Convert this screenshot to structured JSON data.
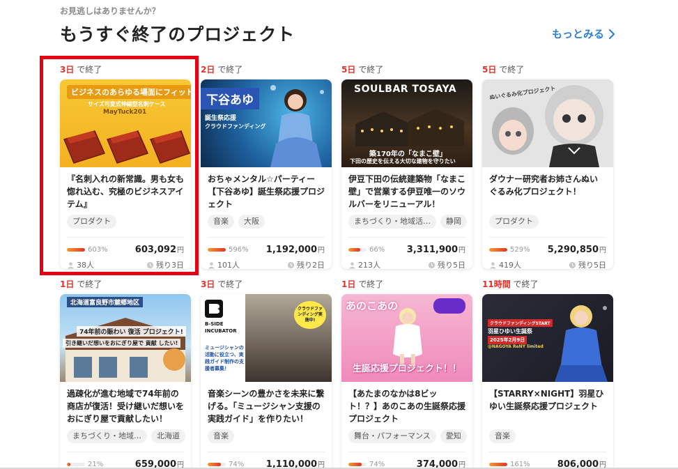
{
  "header": {
    "eyebrow": "お見逃しはありませんか？",
    "title": "もうすぐ終了のプロジェクト",
    "more_link": "もっとみる"
  },
  "cards": [
    {
      "deadline_num": "3日",
      "deadline_suffix": "で終了",
      "thumb_lines": [
        "ビジネスのあらゆる場面にフィット",
        "サイズ可変式伸縮型名刺ケース",
        "MayTuck201"
      ],
      "title": "『名刺入れの新常識。男も女も惚れ込む、究極のビジネスアイテム』",
      "tags": [
        "プロダクト"
      ],
      "percent_text": "603%",
      "percent": 603,
      "amount": "603,092",
      "yen": "円",
      "supporters": "38人",
      "remaining": "残り3日"
    },
    {
      "deadline_num": "2日",
      "deadline_suffix": "で終了",
      "thumb_lines": [
        "下谷あゆ",
        "誕生祭応援",
        "クラウドファンディング"
      ],
      "title": "おちゃメンタル☆パーティー【下谷あゆ】誕生祭応援プロジェクト",
      "tags": [
        "音楽",
        "大阪"
      ],
      "percent_text": "596%",
      "percent": 596,
      "amount": "1,192,000",
      "yen": "円",
      "supporters": "101人",
      "remaining": "残り2日"
    },
    {
      "deadline_num": "5日",
      "deadline_suffix": "で終了",
      "thumb_lines": [
        "SOULBAR TOSAYA",
        "築170年の「なまこ壁」",
        "下田の歴史を伝える大切な建物を守りたい"
      ],
      "title": "伊豆下田の伝統建築物「なまこ壁」で営業する伊豆唯一のソウルバーをリニューアル！",
      "tags": [
        "まちづくり・地域活…",
        "静岡"
      ],
      "percent_text": "66%",
      "percent": 66,
      "amount": "3,311,900",
      "yen": "円",
      "supporters": "213人",
      "remaining": "残り5日"
    },
    {
      "deadline_num": "5日",
      "deadline_suffix": "で終了",
      "thumb_lines": [
        "ぬいぐるみ化プロジェクト"
      ],
      "title": "ダウナー研究者お姉さんぬいぐるみ化プロジェクト！",
      "tags": [
        "プロダクト"
      ],
      "percent_text": "529%",
      "percent": 529,
      "amount": "5,290,850",
      "yen": "円",
      "supporters": "419人",
      "remaining": "残り5日"
    },
    {
      "deadline_num": "1日",
      "deadline_suffix": "で終了",
      "thumb_lines": [
        "北海道富良野市麓郷地区",
        "74年前の賑わい 復活 プロジェクト!",
        "引き継いだ想いをおにぎり屋で 貢献 したい!"
      ],
      "title": "過疎化が進む地域で74年前の商店が復活！受け継いだ想いをおにぎり屋で貢献したい！",
      "tags": [
        "まちづくり・地域…",
        "北海道"
      ],
      "percent_text": "21%",
      "percent": 21,
      "amount": "659,000",
      "yen": "円",
      "supporters": "",
      "remaining": ""
    },
    {
      "deadline_num": "3日",
      "deadline_suffix": "で終了",
      "thumb_lines": [
        "B-SIDE INCUBATOR",
        "ミュージシャンの活動に役立つ、実践ガイド制作の支援者募集！",
        "クラウドファンディング実施中!"
      ],
      "title": "音楽シーンの豊かさを未来に繋げる。「ミュージシャン支援の実践ガイド」を作りたい！",
      "tags": [
        "音楽"
      ],
      "percent_text": "74%",
      "percent": 74,
      "amount": "1,110,000",
      "yen": "円",
      "supporters": "",
      "remaining": ""
    },
    {
      "deadline_num": "1日",
      "deadline_suffix": "で終了",
      "thumb_lines": [
        "あのこあの",
        "生誕応援プロジェクト！！"
      ],
      "title": "【あたまのなかは8ビット！？】あのこあの生誕祭応援プロジェクト",
      "tags": [
        "舞台・パフォーマンス",
        "愛知"
      ],
      "percent_text": "74%",
      "percent": 74,
      "amount": "374,000",
      "yen": "円",
      "supporters": "",
      "remaining": ""
    },
    {
      "deadline_num": "11時間",
      "deadline_suffix": "で終了",
      "thumb_lines": [
        "クラウドファンディングSTART",
        "羽星ひゆい生誕祭",
        "2025年2月9日",
        "@NAGOYA ReNY limited"
      ],
      "title": "【STARRY×NIGHT】羽星ひゆい生誕祭応援プロジェクト",
      "tags": [
        "音楽"
      ],
      "percent_text": "161%",
      "percent": 161,
      "amount": "806,000",
      "yen": "円",
      "supporters": "",
      "remaining": ""
    }
  ],
  "colors": {
    "accent_red": "#e0332a",
    "link_blue": "#2f7fd6",
    "highlight": "#e60012"
  },
  "icons": {
    "more": "chevron-right-icon",
    "supporters": "person-icon",
    "remaining": "clock-icon"
  }
}
